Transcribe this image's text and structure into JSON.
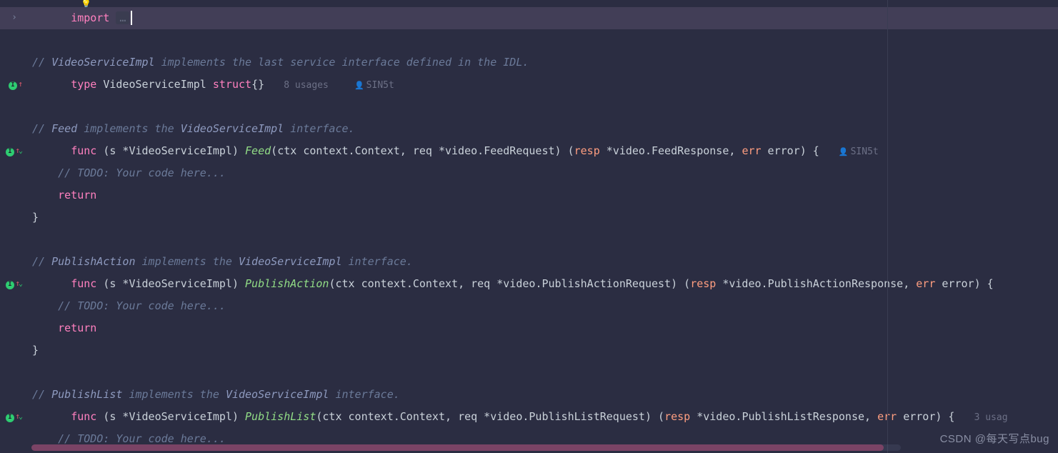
{
  "topbar": {
    "bulb": "💡"
  },
  "import_line": {
    "arrow": "›",
    "kw": "import",
    "dots": "…"
  },
  "cmt_service": {
    "slash": "// ",
    "name": "VideoServiceImpl ",
    "text": "implements the last service interface defined in the IDL."
  },
  "typedecl": {
    "type_kw": "type",
    "name": "VideoServiceImpl",
    "struct_kw": "struct",
    "braces": "{}",
    "usages": "8 usages",
    "author": "SIN5t"
  },
  "cmt_feed": {
    "slash": "// ",
    "name": "Feed ",
    "impl": "implements the ",
    "ref": "VideoServiceImpl ",
    "tail": "interface."
  },
  "func_feed": {
    "func": "func",
    "open": "(",
    "recv": "s",
    "star": " *",
    "recvtype": "VideoServiceImpl",
    "close": ") ",
    "name": "Feed",
    "popen": "(",
    "p1": "ctx",
    "p1t": "context",
    "dot1": ".",
    "ctx": "Context",
    "comma": ", ",
    "p2": "req",
    "star2": " *",
    "pkg2": "video",
    "dot2": ".",
    "t2": "FeedRequest",
    "close2": ") (",
    "resp": "resp",
    "star3": " *",
    "pkg3": "video",
    "dot3": ".",
    "t3": "FeedResponse",
    "comma2": ", ",
    "err": "err",
    "errt": " error",
    "close3": ") {",
    "author": "SIN5t"
  },
  "todo": {
    "text": "// TODO: Your code here..."
  },
  "return_kw": "return",
  "close_brace": "}",
  "cmt_pa": {
    "slash": "// ",
    "name": "PublishAction ",
    "impl": "implements the ",
    "ref": "VideoServiceImpl ",
    "tail": "interface."
  },
  "func_pa": {
    "func": "func",
    "open": "(",
    "recv": "s",
    "star": " *",
    "recvtype": "VideoServiceImpl",
    "close": ") ",
    "name": "PublishAction",
    "popen": "(",
    "p1": "ctx",
    "p1t": "context",
    "dot1": ".",
    "ctx": "Context",
    "comma": ", ",
    "p2": "req",
    "star2": " *",
    "pkg2": "video",
    "dot2": ".",
    "t2": "PublishActionRequest",
    "close2": ") (",
    "resp": "resp",
    "star3": " *",
    "pkg3": "video",
    "dot3": ".",
    "t3": "PublishActionResponse",
    "comma2": ", ",
    "err": "err",
    "errt": " error",
    "close3": ") {"
  },
  "cmt_pl": {
    "slash": "// ",
    "name": "PublishList ",
    "impl": "implements the ",
    "ref": "VideoServiceImpl ",
    "tail": "interface."
  },
  "func_pl": {
    "func": "func",
    "open": "(",
    "recv": "s",
    "star": " *",
    "recvtype": "VideoServiceImpl",
    "close": ") ",
    "name": "PublishList",
    "popen": "(",
    "p1": "ctx",
    "p1t": "context",
    "dot1": ".",
    "ctx": "Context",
    "comma": ", ",
    "p2": "req",
    "star2": " *",
    "pkg2": "video",
    "dot2": ".",
    "t2": "PublishListRequest",
    "close2": ") (",
    "resp": "resp",
    "star3": " *",
    "pkg3": "video",
    "dot3": ".",
    "t3": "PublishListResponse",
    "comma2": ", ",
    "err": "err",
    "errt": " error",
    "close3": ") {",
    "usages": "3 usag"
  },
  "watermark": "CSDN @每天写点bug"
}
